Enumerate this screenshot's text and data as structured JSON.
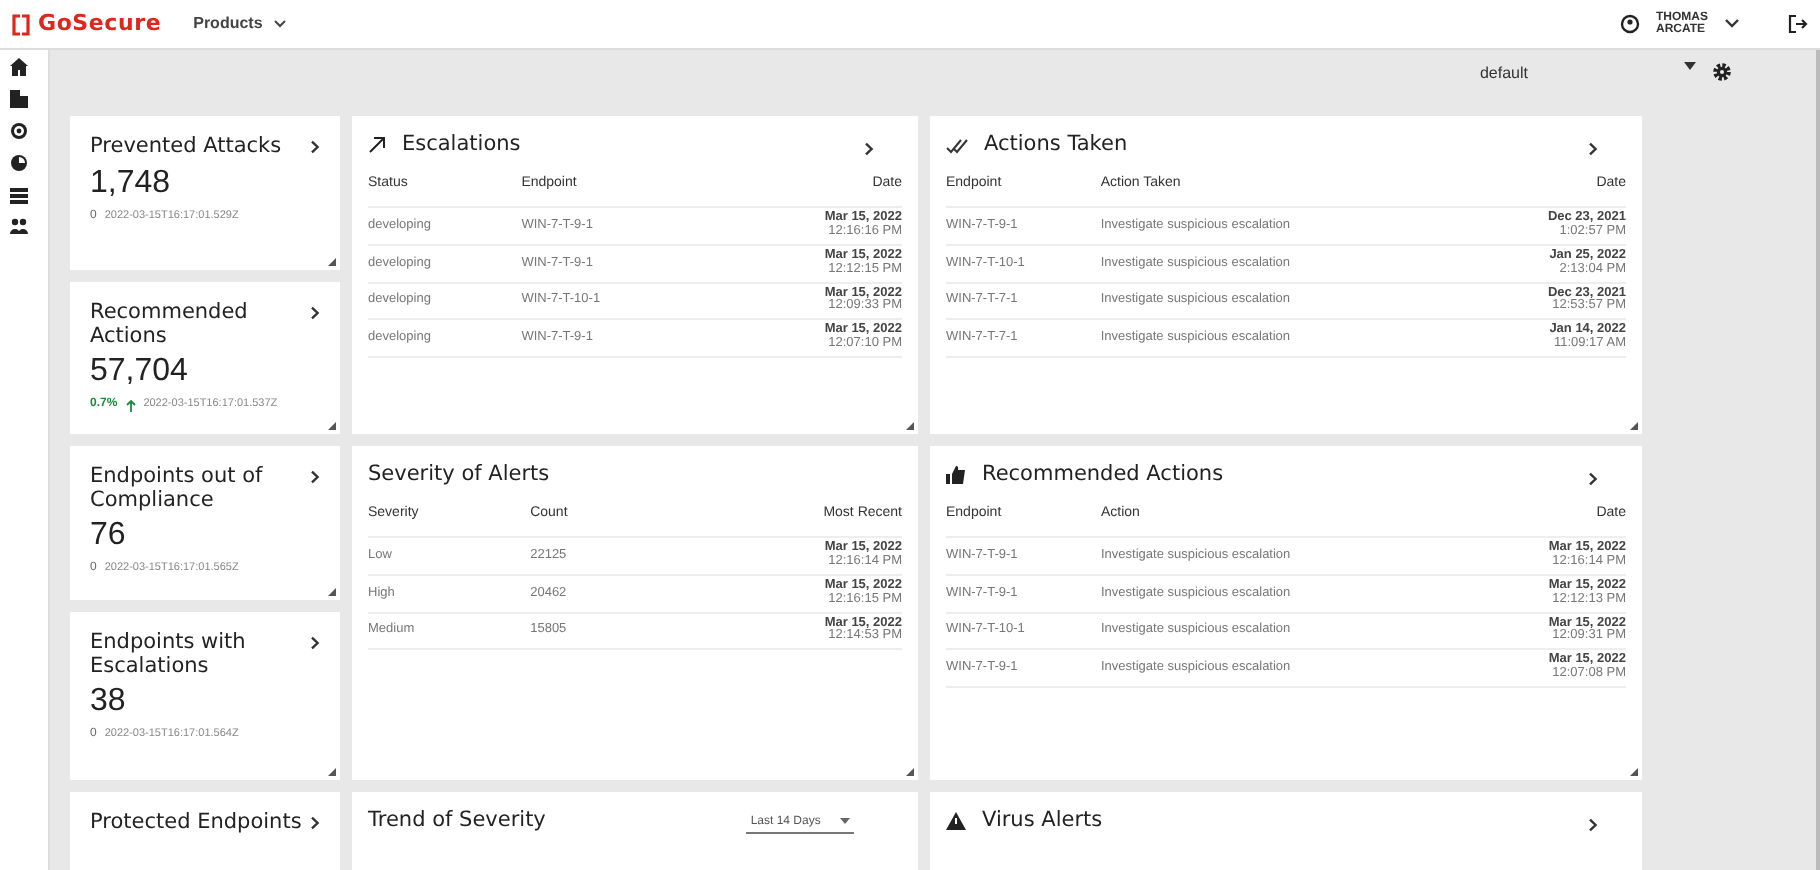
{
  "header": {
    "logo": "GoSecure",
    "products_menu": "Products",
    "user_first": "THOMAS",
    "user_last": "ARCATE"
  },
  "filter": {
    "value": "default"
  },
  "stats": [
    {
      "title": "Prevented Attacks",
      "value": "1,748",
      "change": "0",
      "rising": false,
      "timestamp": "2022-03-15T16:17:01.529Z"
    },
    {
      "title": "Recommended Actions",
      "value": "57,704",
      "change": "0.7%",
      "rising": true,
      "timestamp": "2022-03-15T16:17:01.537Z"
    },
    {
      "title": "Endpoints out of Compliance",
      "value": "76",
      "change": "0",
      "rising": false,
      "timestamp": "2022-03-15T16:17:01.565Z"
    },
    {
      "title": "Endpoints with Escalations",
      "value": "38",
      "change": "0",
      "rising": false,
      "timestamp": "2022-03-15T16:17:01.564Z"
    },
    {
      "title": "Protected Endpoints"
    }
  ],
  "escalations": {
    "title": "Escalations",
    "columns": [
      "Status",
      "Endpoint",
      "Date"
    ],
    "rows": [
      [
        {
          "text": "developing"
        },
        {
          "text": "WIN-7-T-9-1"
        },
        {
          "date": "Mar 15, 2022",
          "time": "12:16:16 PM"
        }
      ],
      [
        {
          "text": "developing"
        },
        {
          "text": "WIN-7-T-9-1"
        },
        {
          "date": "Mar 15, 2022",
          "time": "12:12:15 PM"
        }
      ],
      [
        {
          "text": "developing"
        },
        {
          "text": "WIN-7-T-10-1"
        },
        {
          "date": "Mar 15, 2022",
          "time": "12:09:33 PM"
        }
      ],
      [
        {
          "text": "developing"
        },
        {
          "text": "WIN-7-T-9-1"
        },
        {
          "date": "Mar 15, 2022",
          "time": "12:07:10 PM"
        }
      ]
    ]
  },
  "actions_taken": {
    "title": "Actions Taken",
    "columns": [
      "Endpoint",
      "Action Taken",
      "Date"
    ],
    "rows": [
      [
        {
          "text": "WIN-7-T-9-1"
        },
        {
          "text": "Investigate suspicious escalation"
        },
        {
          "date": "Dec 23, 2021",
          "time": "1:02:57 PM"
        }
      ],
      [
        {
          "text": "WIN-7-T-10-1"
        },
        {
          "text": "Investigate suspicious escalation"
        },
        {
          "date": "Jan 25, 2022",
          "time": "2:13:04 PM"
        }
      ],
      [
        {
          "text": "WIN-7-T-7-1"
        },
        {
          "text": "Investigate suspicious escalation"
        },
        {
          "date": "Dec 23, 2021",
          "time": "12:53:57 PM"
        }
      ],
      [
        {
          "text": "WIN-7-T-7-1"
        },
        {
          "text": "Investigate suspicious escalation"
        },
        {
          "date": "Jan 14, 2022",
          "time": "11:09:17 AM"
        }
      ]
    ]
  },
  "severity_of_alerts": {
    "title": "Severity of Alerts",
    "columns": [
      "Severity",
      "Count",
      "Most Recent"
    ],
    "rows": [
      [
        {
          "text": "Low"
        },
        {
          "text": "22125"
        },
        {
          "date": "Mar 15, 2022",
          "time": "12:16:14 PM"
        }
      ],
      [
        {
          "text": "High"
        },
        {
          "text": "20462"
        },
        {
          "date": "Mar 15, 2022",
          "time": "12:16:15 PM"
        }
      ],
      [
        {
          "text": "Medium"
        },
        {
          "text": "15805"
        },
        {
          "date": "Mar 15, 2022",
          "time": "12:14:53 PM"
        }
      ]
    ]
  },
  "recommended_actions": {
    "title": "Recommended Actions",
    "columns": [
      "Endpoint",
      "Action",
      "Date"
    ],
    "rows": [
      [
        {
          "text": "WIN-7-T-9-1"
        },
        {
          "text": "Investigate suspicious escalation"
        },
        {
          "date": "Mar 15, 2022",
          "time": "12:16:14 PM"
        }
      ],
      [
        {
          "text": "WIN-7-T-9-1"
        },
        {
          "text": "Investigate suspicious escalation"
        },
        {
          "date": "Mar 15, 2022",
          "time": "12:12:13 PM"
        }
      ],
      [
        {
          "text": "WIN-7-T-10-1"
        },
        {
          "text": "Investigate suspicious escalation"
        },
        {
          "date": "Mar 15, 2022",
          "time": "12:09:31 PM"
        }
      ],
      [
        {
          "text": "WIN-7-T-9-1"
        },
        {
          "text": "Investigate suspicious escalation"
        },
        {
          "date": "Mar 15, 2022",
          "time": "12:07:08 PM"
        }
      ]
    ]
  },
  "trend_of_severity": {
    "title": "Trend of Severity",
    "range": "Last 14 Days"
  },
  "virus_alerts": {
    "title": "Virus Alerts"
  }
}
